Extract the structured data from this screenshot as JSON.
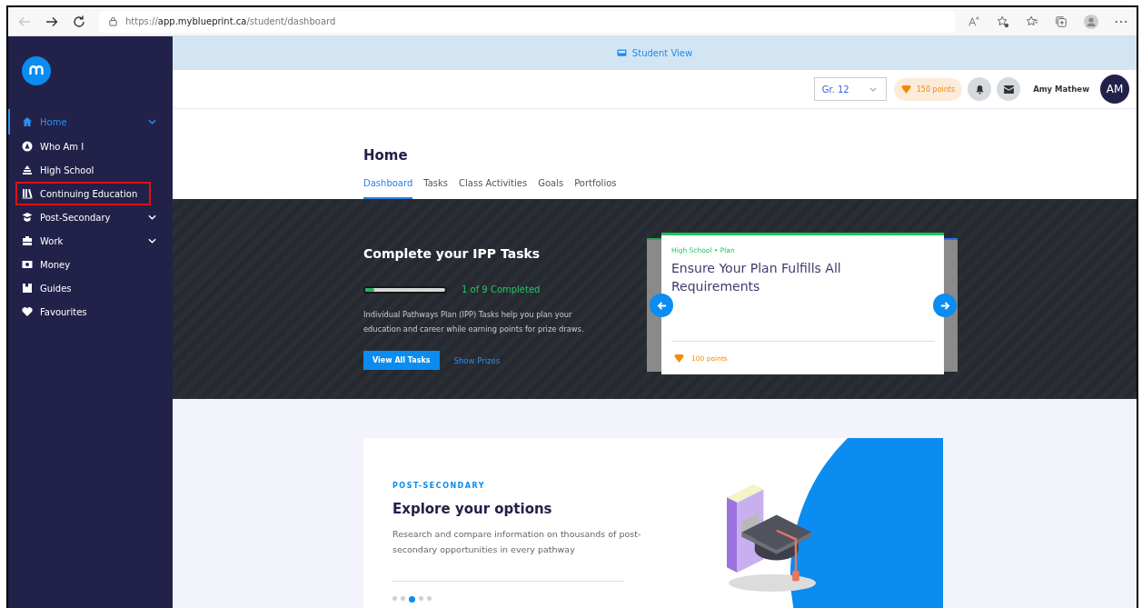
{
  "browser": {
    "url": "https://**app.myblueprint.ca**/student/dashboard"
  },
  "sidebar": {
    "items": [
      {
        "label": "Home",
        "kind": "home",
        "selected": true,
        "expandable": true,
        "highlighted": false
      },
      {
        "label": "Who Am I",
        "kind": "compass",
        "selected": false,
        "expandable": false,
        "highlighted": false
      },
      {
        "label": "High School",
        "kind": "school",
        "selected": false,
        "expandable": false,
        "highlighted": false
      },
      {
        "label": "Continuing Education",
        "kind": "books",
        "selected": false,
        "expandable": false,
        "highlighted": true
      },
      {
        "label": "Post-Secondary",
        "kind": "cap",
        "selected": false,
        "expandable": true,
        "highlighted": false
      },
      {
        "label": "Work",
        "kind": "briefcase",
        "selected": false,
        "expandable": true,
        "highlighted": false
      },
      {
        "label": "Money",
        "kind": "money",
        "selected": false,
        "expandable": false,
        "highlighted": false
      },
      {
        "label": "Guides",
        "kind": "guide",
        "selected": false,
        "expandable": false,
        "highlighted": false
      },
      {
        "label": "Favourites",
        "kind": "heart",
        "selected": false,
        "expandable": false,
        "highlighted": false
      }
    ]
  },
  "student_view_bar": {
    "label": "Student View"
  },
  "header": {
    "grade": "Gr. 12",
    "points": "150 points",
    "user_name": "Amy Mathew",
    "avatar_initials": "AM"
  },
  "page": {
    "title": "Home",
    "tabs": [
      {
        "label": "Dashboard",
        "selected": true
      },
      {
        "label": "Tasks",
        "selected": false
      },
      {
        "label": "Class Activities",
        "selected": false
      },
      {
        "label": "Goals",
        "selected": false
      },
      {
        "label": "Portfolios",
        "selected": false
      }
    ]
  },
  "ipp": {
    "title": "Complete your IPP Tasks",
    "progress": {
      "level": 0.11,
      "label": "1 of 9 Completed"
    },
    "description": "Individual Pathways Plan (IPP) Tasks help you plan your education and career while earning points for prize draws.",
    "primary_button": "View All Tasks",
    "link": "Show Prizes"
  },
  "task_card": {
    "category": "High School • Plan",
    "title": "Ensure Your Plan Fulfills All Requirements",
    "points": "100 points"
  },
  "explore": {
    "eyebrow": "POST-SECONDARY",
    "title": "Explore your options",
    "description": "Research and compare information on thousands of post-secondary opportunities in every pathway",
    "dots": [
      {
        "selected": false
      },
      {
        "selected": false
      },
      {
        "selected": true
      },
      {
        "selected": false
      },
      {
        "selected": false
      }
    ]
  }
}
